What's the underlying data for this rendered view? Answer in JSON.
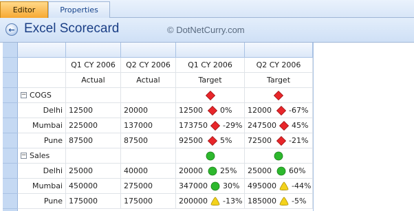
{
  "tabs": [
    {
      "label": "Editor",
      "active": true
    },
    {
      "label": "Properties",
      "active": false
    }
  ],
  "header": {
    "title": "Excel Scorecard",
    "watermark": "© DotNetCurry.com"
  },
  "columns": [
    {
      "period": "Q1 CY 2006",
      "kind": "Actual"
    },
    {
      "period": "Q2 CY 2006",
      "kind": "Actual"
    },
    {
      "period": "Q1 CY 2006",
      "kind": "Target"
    },
    {
      "period": "Q2 CY 2006",
      "kind": "Target"
    }
  ],
  "groups": [
    {
      "label": "COGS",
      "expander": "−",
      "status": [
        "red-diamond",
        "red-diamond"
      ],
      "rows": [
        {
          "label": "Delhi",
          "q1_actual": "12500",
          "q2_actual": "20000",
          "q1_target": {
            "value": "12500",
            "icon": "red-diamond",
            "pct": "0%"
          },
          "q2_target": {
            "value": "12000",
            "icon": "red-diamond",
            "pct": "-67%"
          }
        },
        {
          "label": "Mumbai",
          "q1_actual": "225000",
          "q2_actual": "137000",
          "q1_target": {
            "value": "173750",
            "icon": "red-diamond",
            "pct": "-29%"
          },
          "q2_target": {
            "value": "247500",
            "icon": "red-diamond",
            "pct": "45%"
          }
        },
        {
          "label": "Pune",
          "q1_actual": "87500",
          "q2_actual": "87500",
          "q1_target": {
            "value": "92500",
            "icon": "red-diamond",
            "pct": "5%"
          },
          "q2_target": {
            "value": "72500",
            "icon": "red-diamond",
            "pct": "-21%"
          }
        }
      ]
    },
    {
      "label": "Sales",
      "expander": "−",
      "status": [
        "green-circle",
        "green-circle"
      ],
      "rows": [
        {
          "label": "Delhi",
          "q1_actual": "25000",
          "q2_actual": "40000",
          "q1_target": {
            "value": "20000",
            "icon": "green-circle",
            "pct": "25%"
          },
          "q2_target": {
            "value": "25000",
            "icon": "green-circle",
            "pct": "60%"
          }
        },
        {
          "label": "Mumbai",
          "q1_actual": "450000",
          "q2_actual": "275000",
          "q1_target": {
            "value": "347000",
            "icon": "green-circle",
            "pct": "30%"
          },
          "q2_target": {
            "value": "495000",
            "icon": "yellow-triangle",
            "pct": "-44%"
          }
        },
        {
          "label": "Pune",
          "q1_actual": "175000",
          "q2_actual": "175000",
          "q1_target": {
            "value": "200000",
            "icon": "yellow-triangle",
            "pct": "-13%"
          },
          "q2_target": {
            "value": "185000",
            "icon": "yellow-triangle",
            "pct": "-5%"
          }
        }
      ]
    }
  ],
  "colors": {
    "red": "#e8262a",
    "green": "#2db82d",
    "yellow": "#f3d21c",
    "title": "#1b3f86"
  }
}
